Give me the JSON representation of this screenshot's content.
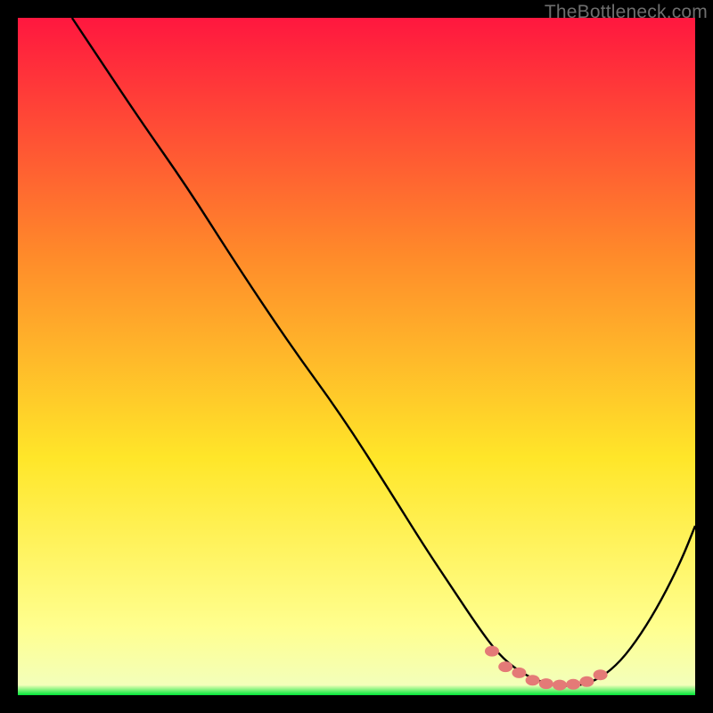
{
  "watermark": "TheBottleneck.com",
  "colors": {
    "bg": "#000000",
    "grad_top": "#ff173f",
    "grad_mid1": "#ff8a2a",
    "grad_mid2": "#ffe629",
    "grad_low": "#ffff8f",
    "grad_bottom": "#00e637",
    "curve": "#000000",
    "marker": "#e47a77"
  },
  "chart_data": {
    "type": "line",
    "title": "",
    "xlabel": "",
    "ylabel": "",
    "xlim": [
      0,
      100
    ],
    "ylim": [
      0,
      100
    ],
    "series": [
      {
        "name": "bottleneck-curve",
        "x": [
          8,
          12,
          18,
          25,
          32,
          40,
          48,
          55,
          60,
          64,
          68,
          71,
          74,
          77,
          80,
          83,
          86,
          89,
          92,
          95,
          98,
          100
        ],
        "y": [
          100,
          94,
          85,
          75,
          64,
          52,
          41,
          30,
          22,
          16,
          10,
          6,
          3.5,
          2,
          1.4,
          1.4,
          2.5,
          5,
          9,
          14,
          20,
          25
        ]
      }
    ],
    "markers": {
      "name": "best-range",
      "x": [
        70,
        72,
        74,
        76,
        78,
        80,
        82,
        84,
        86
      ],
      "y": [
        6.5,
        4.2,
        3.3,
        2.2,
        1.7,
        1.5,
        1.6,
        2.0,
        3.0
      ]
    }
  }
}
